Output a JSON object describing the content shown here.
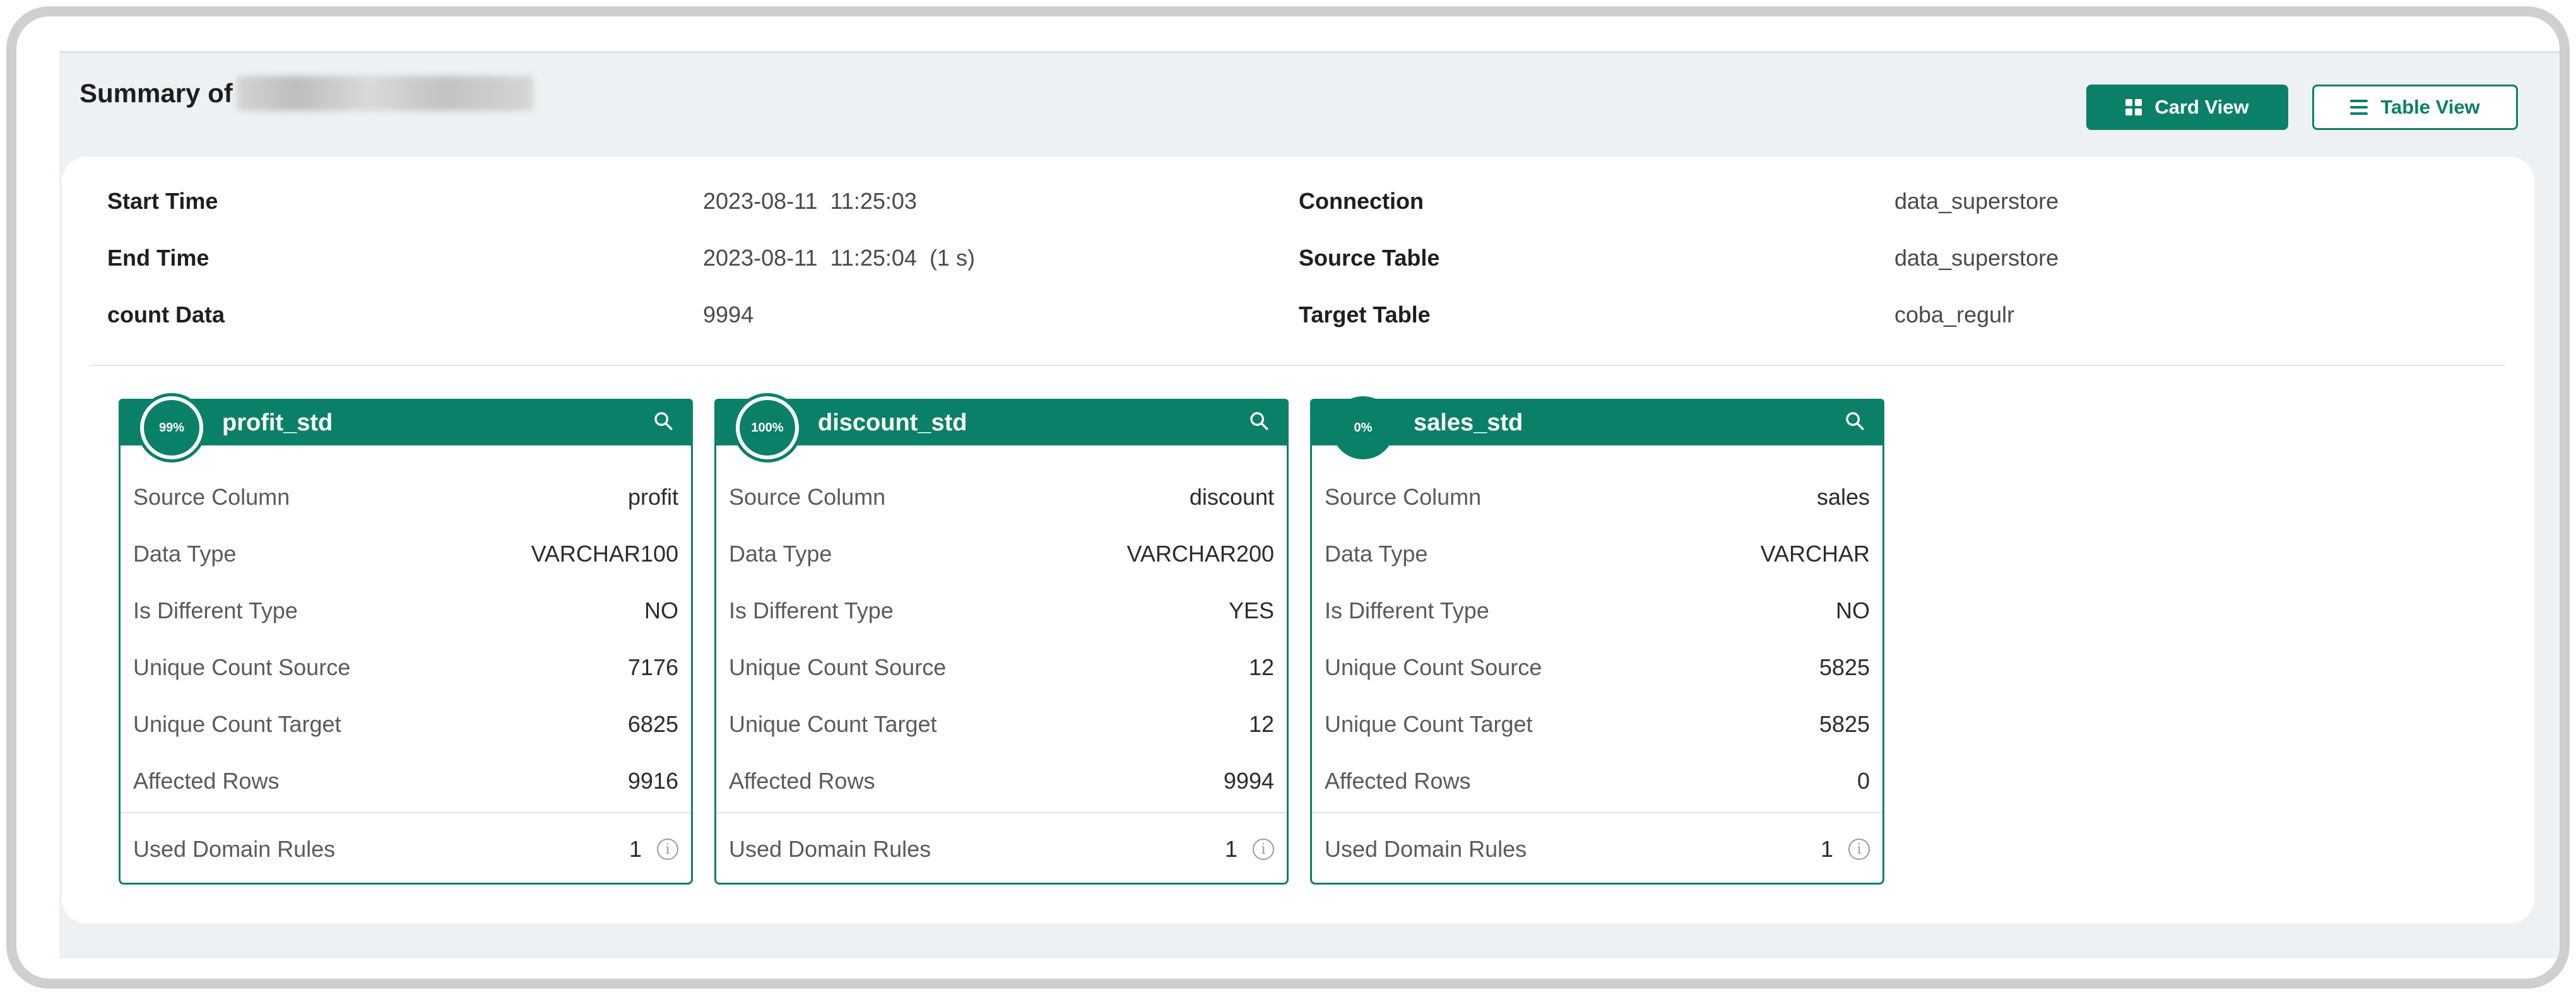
{
  "header": {
    "title": "Summary of",
    "card_view_label": "Card View",
    "table_view_label": "Table View"
  },
  "info": {
    "start_time_label": "Start Time",
    "start_time_value": "2023-08-11  11:25:03",
    "end_time_label": "End Time",
    "end_time_value": "2023-08-11  11:25:04  (1 s)",
    "count_label": "count Data",
    "count_value": "9994",
    "connection_label": "Connection",
    "connection_value": "data_superstore",
    "source_table_label": "Source Table",
    "source_table_value": "data_superstore",
    "target_table_label": "Target Table",
    "target_table_value": "coba_regulr"
  },
  "labels": {
    "source_column": "Source Column",
    "data_type": "Data Type",
    "is_different_type": "Is Different Type",
    "unique_count_source": "Unique Count Source",
    "unique_count_target": "Unique Count Target",
    "affected_rows": "Affected Rows",
    "used_domain_rules": "Used Domain Rules"
  },
  "cards": [
    {
      "percent": "99%",
      "name": "profit_std",
      "source_column": "profit",
      "data_type": "VARCHAR100",
      "is_different_type": "NO",
      "unique_count_source": "7176",
      "unique_count_target": "6825",
      "affected_rows": "9916",
      "used_domain_rules": "1"
    },
    {
      "percent": "100%",
      "name": "discount_std",
      "source_column": "discount",
      "data_type": "VARCHAR200",
      "is_different_type": "YES",
      "unique_count_source": "12",
      "unique_count_target": "12",
      "affected_rows": "9994",
      "used_domain_rules": "1"
    },
    {
      "percent": "0%",
      "name": "sales_std",
      "source_column": "sales",
      "data_type": "VARCHAR",
      "is_different_type": "NO",
      "unique_count_source": "5825",
      "unique_count_target": "5825",
      "affected_rows": "0",
      "used_domain_rules": "1"
    }
  ],
  "colors": {
    "accent": "#0b8068",
    "panel_bg": "#eef1f3"
  },
  "icons": {
    "card_view": "grid-icon",
    "table_view": "list-icon",
    "card_search": "search-icon",
    "rule_info": "info-icon"
  }
}
